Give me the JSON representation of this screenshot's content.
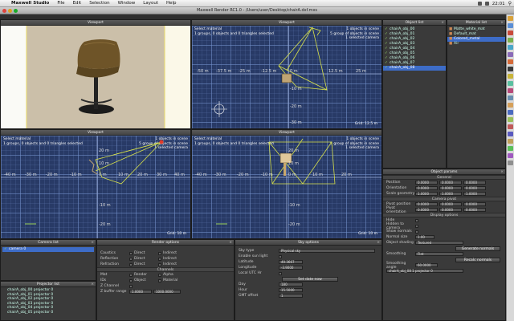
{
  "menubar": {
    "app": "Maxwell Studio",
    "items": [
      "File",
      "Edit",
      "Selection",
      "Window",
      "Layout",
      "Help"
    ],
    "clock": "22:01"
  },
  "window": {
    "title": "Maxwell Render RC1.0 - /Users/user/Desktop/chairA.dxf.mxs"
  },
  "viewports": {
    "perspective": {
      "title": "Viewport"
    },
    "top": {
      "title": "Viewport",
      "info_left": [
        "Select material",
        "1 groups, 0 objects and 0 triangles selected"
      ],
      "info_right": [
        "1 objects in scene",
        "5 group of objects in scene",
        "1 selected camera"
      ],
      "grid": "Grid: 12.5 m",
      "xticks": [
        "-50 m",
        "-37.5 m",
        "-25 m",
        "-12.5 m",
        "0 m",
        "12.5 m",
        "25 m"
      ],
      "yticks": [
        "-10 m",
        "-20 m",
        "-30 m"
      ]
    },
    "front": {
      "title": "Viewport",
      "info_left": [
        "Select material",
        "1 groups, 0 objects and 0 triangles selected"
      ],
      "info_right": [
        "1 objects in scene",
        "5 group of objects in scene",
        "1 selected camera"
      ],
      "grid": "Grid: 10 m",
      "xticks": [
        "-40 m",
        "-30 m",
        "-20 m",
        "-10 m",
        "0 m",
        "10 m",
        "20 m",
        "30 m",
        "40 m"
      ],
      "yticks": [
        "20 m",
        "10 m",
        "-10 m",
        "-20 m"
      ]
    },
    "side": {
      "title": "Viewport",
      "info_left": [
        "Select material",
        "1 groups, 0 objects and 0 triangles selected"
      ],
      "info_right": [
        "1 objects in scene",
        "5 group of objects in scene",
        "1 selected camera"
      ],
      "grid": "Grid: 10 m",
      "xticks": [
        "-40 m",
        "-30 m",
        "-20 m",
        "-10 m",
        "0 m",
        "10 m",
        "20 m"
      ],
      "yticks": [
        "20 m",
        "10 m",
        "-10 m",
        "-20 m"
      ]
    }
  },
  "object_list": {
    "title": "Object list",
    "items": [
      "chairA_obj_00",
      "chairA_obj_01",
      "chairA_obj_02",
      "chairA_obj_03",
      "chairA_obj_04",
      "chairA_obj_05",
      "chairA_obj_06",
      "chairA_obj_07",
      "chairA_obj_08"
    ]
  },
  "material_list": {
    "title": "Material list",
    "items": [
      "Matte_white_mat",
      "Default_mat",
      "Colored_metal",
      "Air"
    ],
    "selected": 2
  },
  "object_params": {
    "title": "Object params",
    "general": "General",
    "position": {
      "label": "Position",
      "values": [
        "0.0000",
        "0.0000",
        "0.0000"
      ]
    },
    "orientation": {
      "label": "Orientation",
      "values": [
        "0.0000",
        "0.0000",
        "0.0000"
      ]
    },
    "scale": {
      "label": "Scale geometry",
      "values": [
        "1.0000",
        "1.0000",
        "1.0000"
      ]
    },
    "camera_pivot": "Camera pivot",
    "pivot_position": {
      "label": "Pivot position",
      "values": [
        "0.0000",
        "0.0000",
        "0.0000"
      ]
    },
    "pivot_orientation": {
      "label": "Pivot orientation",
      "values": [
        "0.0000",
        "0.0000",
        "0.0000"
      ]
    },
    "display_options": "Display options",
    "hide": "Hide",
    "hidden_camera": "Hidden to camera",
    "show_normals": "Show normals",
    "normal_size": {
      "label": "Normal size",
      "value": "1.00"
    },
    "object_shading": {
      "label": "Object shading",
      "value": "Textured"
    },
    "generate_normals": "Generate normals",
    "smoothing": {
      "label": "Smoothing",
      "value": "Flat"
    },
    "recalc_normals": "Recalc normals",
    "smoothing_angle": {
      "label": "Smoothing angle",
      "value": "60.0000"
    },
    "footer": "chairA_obj_08  1 projector 0"
  },
  "camera_list": {
    "title": "Camera list",
    "items": [
      "camera 0"
    ]
  },
  "projector_list": {
    "title": "Projector list",
    "items": [
      "chairA_obj_00 projector 0",
      "chairA_obj_01 projector 0",
      "chairA_obj_02 projector 0",
      "chairA_obj_03 projector 0",
      "chairA_obj_04 projector 0",
      "chairA_obj_05 projector 0"
    ]
  },
  "render_options": {
    "title": "Render options",
    "rows": [
      {
        "label": "Caustics",
        "a": "Direct",
        "b": "Indirect"
      },
      {
        "label": "Reflection",
        "a": "Direct",
        "b": "Indirect"
      },
      {
        "label": "Refraction",
        "a": "Direct",
        "b": "Indirect"
      }
    ],
    "channels": "Channels",
    "channel_rows": [
      {
        "label": "Mat",
        "a": "Render",
        "b": "Alpha"
      },
      {
        "label": "IDs",
        "a": "Object",
        "b": "Material"
      },
      {
        "label": "Z Channel",
        "a": "",
        "b": ""
      },
      {
        "label": "Z buffer range",
        "a": "1.0000",
        "b": "1000.0000"
      }
    ]
  },
  "sky_options": {
    "title": "Sky options",
    "sky_type": {
      "label": "Sky type",
      "value": "Physical sky"
    },
    "rows": [
      {
        "label": "Enable sun light",
        "value": ""
      },
      {
        "label": "Latitude",
        "value": "40.3667"
      },
      {
        "label": "Longitude",
        "value": "-3.9000"
      },
      {
        "label": "Local UTC Hr",
        "value": ""
      }
    ],
    "set_now": "Set date now",
    "rows2": [
      {
        "label": "Day",
        "value": "180"
      },
      {
        "label": "Hour",
        "value": "15.5000"
      },
      {
        "label": "GMT offset",
        "value": "1"
      }
    ]
  },
  "colors": {
    "grid_bg": "#283a66",
    "wire": "#d6e04a",
    "selection": "#3d6cc7",
    "panel": "#3a3a3a"
  }
}
